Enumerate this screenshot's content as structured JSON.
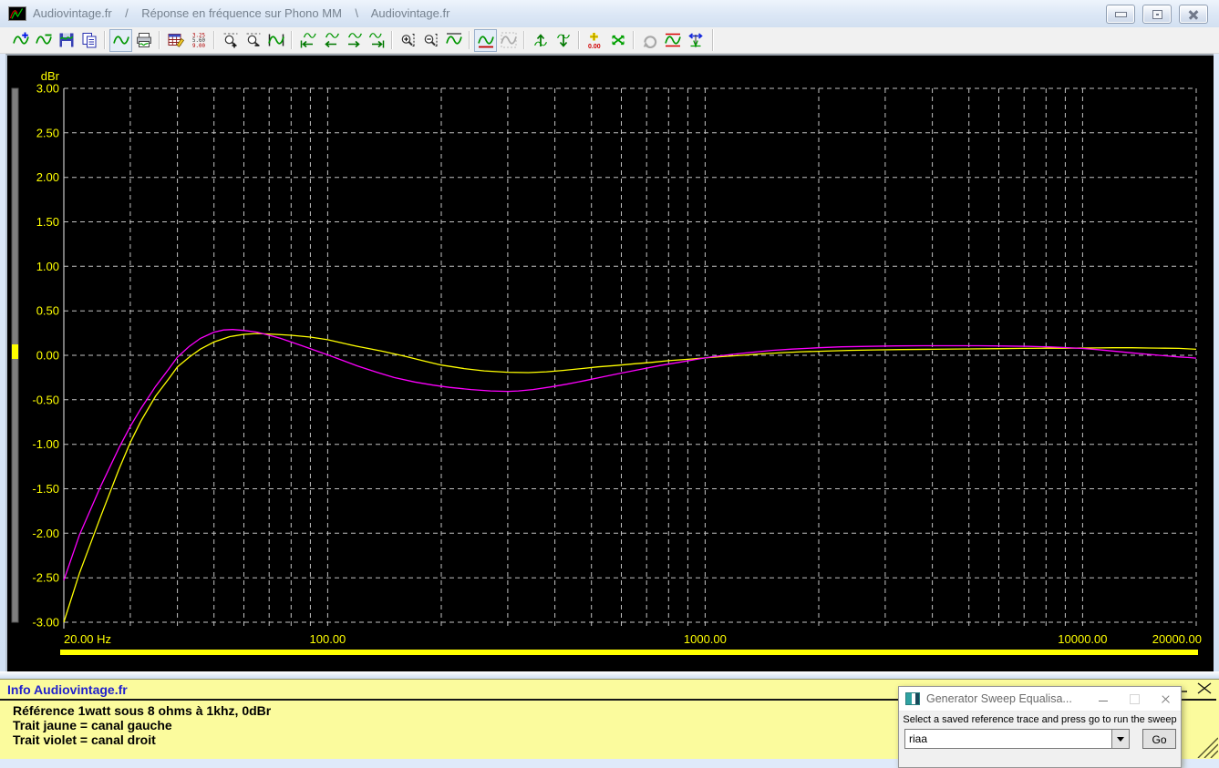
{
  "window": {
    "title": "Audiovintage.fr    /    Réponse en fréquence sur Phono MM    \\    Audiovintage.fr"
  },
  "toolbar": {
    "buttons": [
      {
        "name": "add-trace",
        "icon": "wave-plus"
      },
      {
        "name": "subtract-trace",
        "icon": "wave-minus"
      },
      {
        "name": "save-trace",
        "icon": "save-wave"
      },
      {
        "name": "copy-trace",
        "icon": "copy"
      },
      {
        "sep": true
      },
      {
        "name": "show-graph",
        "icon": "wave-box",
        "pressed": true
      },
      {
        "name": "print-graph",
        "icon": "print-wave"
      },
      {
        "sep": true
      },
      {
        "name": "edit-values-table",
        "icon": "table-edit"
      },
      {
        "name": "show-values-list",
        "icon": "value-list"
      },
      {
        "sep": true
      },
      {
        "name": "zoom-x-in",
        "icon": "zoom-x-in"
      },
      {
        "name": "zoom-x-out",
        "icon": "zoom-x-out"
      },
      {
        "name": "fit-trace-x",
        "icon": "fit-x"
      },
      {
        "sep": true
      },
      {
        "name": "pan-left-end",
        "icon": "pan-left-end"
      },
      {
        "name": "pan-left",
        "icon": "pan-left"
      },
      {
        "name": "pan-right",
        "icon": "pan-right"
      },
      {
        "name": "pan-right-end",
        "icon": "pan-right-end"
      },
      {
        "sep": true
      },
      {
        "name": "zoom-y-in",
        "icon": "zoom-y-in"
      },
      {
        "name": "zoom-y-out",
        "icon": "zoom-y-out"
      },
      {
        "name": "fit-trace-y",
        "icon": "wave-over"
      },
      {
        "sep": true
      },
      {
        "name": "normalize-trace",
        "icon": "normalize",
        "pressed": true
      },
      {
        "name": "align-tool",
        "icon": "gray-tool",
        "disabled": true
      },
      {
        "sep": true
      },
      {
        "name": "shift-trace-up",
        "icon": "shift-up"
      },
      {
        "name": "shift-trace-down",
        "icon": "shift-down"
      },
      {
        "sep": true
      },
      {
        "name": "zero-offset",
        "icon": "zero-offset"
      },
      {
        "name": "splice-traces",
        "icon": "splice"
      },
      {
        "sep": true
      },
      {
        "name": "redo-sweep",
        "icon": "redo-gray",
        "disabled": true
      },
      {
        "name": "limit-lines",
        "icon": "limit-lines"
      },
      {
        "name": "cursor-readout",
        "icon": "cursor-readout"
      }
    ]
  },
  "chart_data": {
    "type": "line",
    "x_scale": "log",
    "x_range": [
      20,
      20000
    ],
    "y_range": [
      -3,
      3
    ],
    "y_step": 0.5,
    "ylabel": "dBr",
    "background": "#000000",
    "grid": true,
    "grid_color": "#c3c3c3",
    "label_color": "#ffff00",
    "sweep_bar_color": "#ffff00",
    "x_ticks": [
      {
        "label": "20.00 Hz",
        "freq": 20,
        "align": "start"
      },
      {
        "label": "100.00",
        "freq": 100,
        "align": "middle"
      },
      {
        "label": "1000.00",
        "freq": 1000,
        "align": "middle"
      },
      {
        "label": "10000.00",
        "freq": 10000,
        "align": "middle"
      },
      {
        "label": "20000.00",
        "freq": 20000,
        "align": "end"
      }
    ],
    "series": [
      {
        "name": "canal gauche",
        "color": "#ffff00",
        "points": [
          [
            20,
            -3.0
          ],
          [
            22,
            -2.45
          ],
          [
            25,
            -1.82
          ],
          [
            28,
            -1.28
          ],
          [
            30,
            -0.98
          ],
          [
            32,
            -0.74
          ],
          [
            35,
            -0.46
          ],
          [
            38,
            -0.26
          ],
          [
            40,
            -0.13
          ],
          [
            43,
            -0.02
          ],
          [
            46,
            0.07
          ],
          [
            50,
            0.15
          ],
          [
            55,
            0.21
          ],
          [
            60,
            0.235
          ],
          [
            65,
            0.245
          ],
          [
            70,
            0.24
          ],
          [
            80,
            0.225
          ],
          [
            90,
            0.205
          ],
          [
            100,
            0.175
          ],
          [
            110,
            0.135
          ],
          [
            120,
            0.1
          ],
          [
            140,
            0.045
          ],
          [
            160,
            -0.01
          ],
          [
            180,
            -0.065
          ],
          [
            200,
            -0.11
          ],
          [
            230,
            -0.15
          ],
          [
            260,
            -0.175
          ],
          [
            300,
            -0.19
          ],
          [
            340,
            -0.195
          ],
          [
            380,
            -0.185
          ],
          [
            420,
            -0.17
          ],
          [
            470,
            -0.15
          ],
          [
            520,
            -0.13
          ],
          [
            580,
            -0.115
          ],
          [
            650,
            -0.095
          ],
          [
            720,
            -0.08
          ],
          [
            800,
            -0.06
          ],
          [
            900,
            -0.045
          ],
          [
            1000,
            -0.03
          ],
          [
            1100,
            -0.015
          ],
          [
            1250,
            0.0
          ],
          [
            1400,
            0.015
          ],
          [
            1600,
            0.03
          ],
          [
            1800,
            0.04
          ],
          [
            2000,
            0.045
          ],
          [
            2400,
            0.055
          ],
          [
            2800,
            0.06
          ],
          [
            3300,
            0.065
          ],
          [
            4000,
            0.068
          ],
          [
            5000,
            0.072
          ],
          [
            6000,
            0.075
          ],
          [
            7000,
            0.078
          ],
          [
            8000,
            0.08
          ],
          [
            9000,
            0.08
          ],
          [
            10000,
            0.082
          ],
          [
            11000,
            0.083
          ],
          [
            12000,
            0.085
          ],
          [
            13500,
            0.085
          ],
          [
            15000,
            0.082
          ],
          [
            16500,
            0.08
          ],
          [
            18000,
            0.078
          ],
          [
            19000,
            0.073
          ],
          [
            20000,
            0.068
          ]
        ]
      },
      {
        "name": "canal droit",
        "color": "#ff00ff",
        "points": [
          [
            20,
            -2.53
          ],
          [
            22,
            -2.02
          ],
          [
            25,
            -1.48
          ],
          [
            28,
            -1.04
          ],
          [
            30,
            -0.8
          ],
          [
            32,
            -0.6
          ],
          [
            35,
            -0.35
          ],
          [
            38,
            -0.15
          ],
          [
            40,
            -0.02
          ],
          [
            43,
            0.1
          ],
          [
            46,
            0.19
          ],
          [
            50,
            0.26
          ],
          [
            53,
            0.285
          ],
          [
            56,
            0.29
          ],
          [
            60,
            0.28
          ],
          [
            65,
            0.26
          ],
          [
            70,
            0.225
          ],
          [
            75,
            0.19
          ],
          [
            80,
            0.15
          ],
          [
            90,
            0.075
          ],
          [
            100,
            0.005
          ],
          [
            110,
            -0.06
          ],
          [
            120,
            -0.12
          ],
          [
            135,
            -0.19
          ],
          [
            150,
            -0.25
          ],
          [
            170,
            -0.3
          ],
          [
            190,
            -0.335
          ],
          [
            210,
            -0.36
          ],
          [
            240,
            -0.385
          ],
          [
            270,
            -0.4
          ],
          [
            300,
            -0.405
          ],
          [
            320,
            -0.4
          ],
          [
            350,
            -0.385
          ],
          [
            390,
            -0.355
          ],
          [
            430,
            -0.325
          ],
          [
            480,
            -0.285
          ],
          [
            540,
            -0.24
          ],
          [
            600,
            -0.2
          ],
          [
            680,
            -0.155
          ],
          [
            760,
            -0.115
          ],
          [
            850,
            -0.08
          ],
          [
            950,
            -0.045
          ],
          [
            1050,
            -0.015
          ],
          [
            1150,
            0.005
          ],
          [
            1300,
            0.03
          ],
          [
            1500,
            0.055
          ],
          [
            1700,
            0.07
          ],
          [
            2000,
            0.085
          ],
          [
            2300,
            0.095
          ],
          [
            2700,
            0.1
          ],
          [
            3200,
            0.105
          ],
          [
            3800,
            0.108
          ],
          [
            4500,
            0.108
          ],
          [
            5300,
            0.107
          ],
          [
            6200,
            0.104
          ],
          [
            7200,
            0.1
          ],
          [
            8200,
            0.094
          ],
          [
            9000,
            0.087
          ],
          [
            10000,
            0.077
          ],
          [
            11000,
            0.063
          ],
          [
            12000,
            0.048
          ],
          [
            13500,
            0.028
          ],
          [
            15000,
            0.01
          ],
          [
            16500,
            -0.005
          ],
          [
            18000,
            -0.018
          ],
          [
            19000,
            -0.025
          ],
          [
            20000,
            -0.032
          ]
        ]
      }
    ]
  },
  "info_panel": {
    "title": "Info Audiovintage.fr",
    "lines": [
      "Référence 1watt sous 8 ohms à 1khz, 0dBr",
      "Trait jaune = canal gauche",
      "Trait violet = canal droit"
    ]
  },
  "dialog": {
    "title": "Generator Sweep Equalisa...",
    "instruction": "Select a saved reference trace and press go to run the sweep",
    "combo_value": "riaa",
    "go_label": "Go"
  }
}
